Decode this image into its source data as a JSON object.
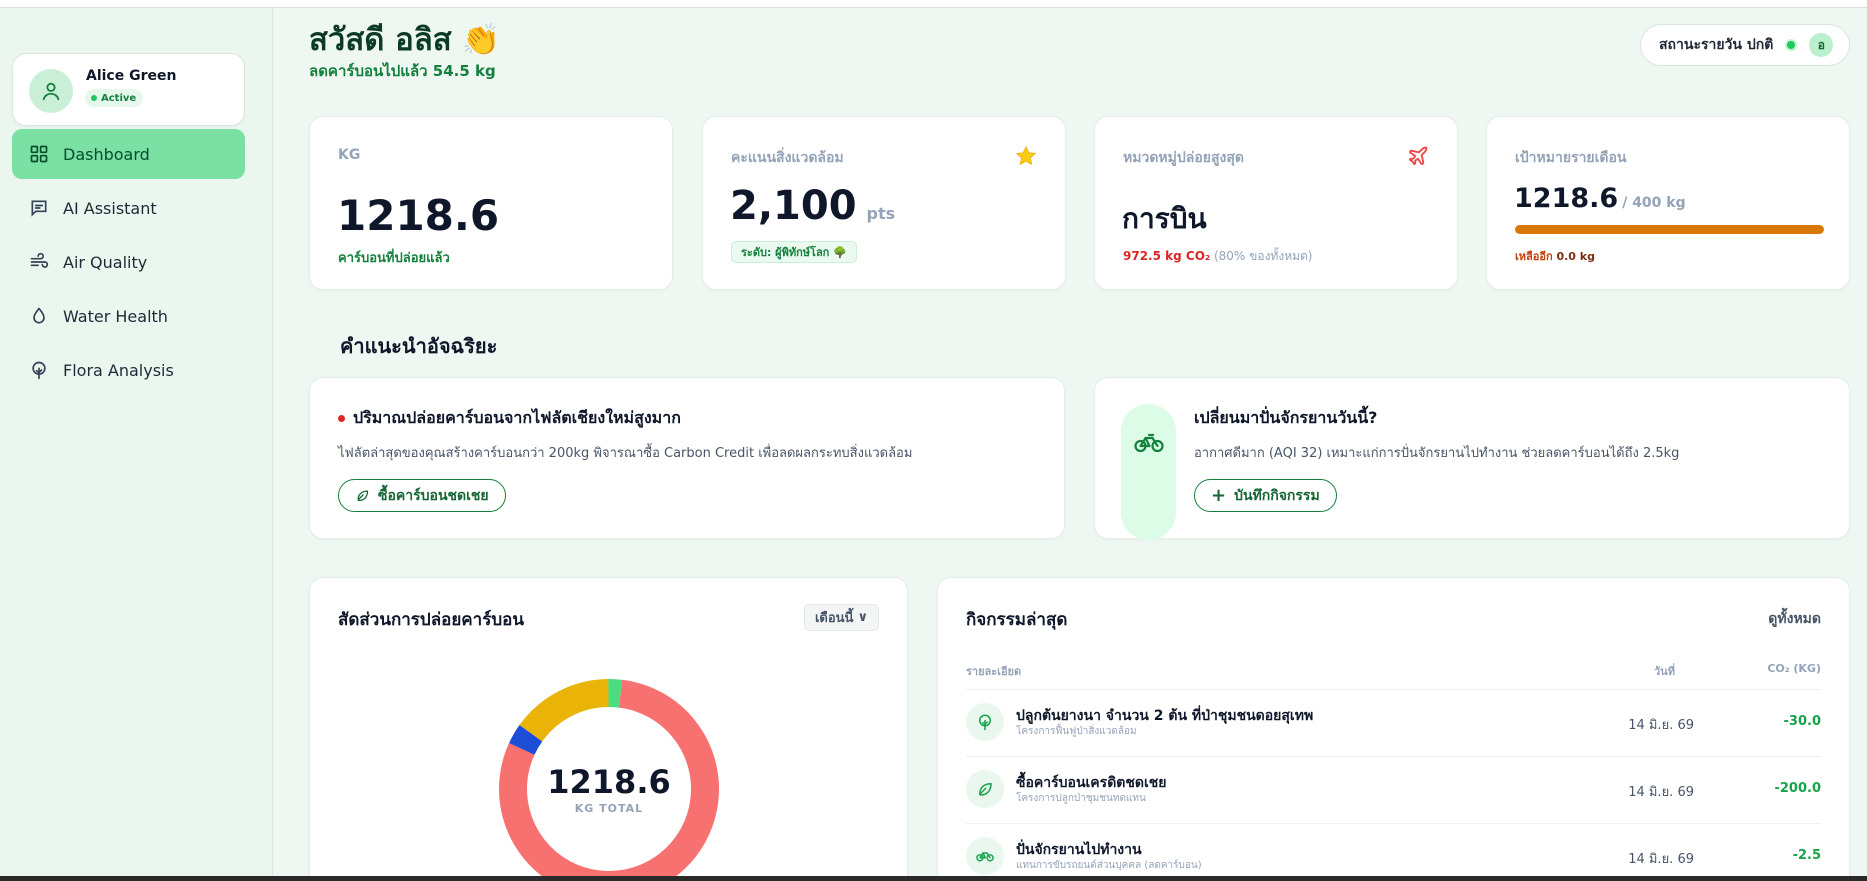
{
  "sidebar": {
    "profile": {
      "name": "Alice Green",
      "status": "Active"
    },
    "items": [
      {
        "label": "Dashboard",
        "icon": "grid-icon",
        "active": true
      },
      {
        "label": "AI Assistant",
        "icon": "chat-icon",
        "active": false
      },
      {
        "label": "Air Quality",
        "icon": "wind-icon",
        "active": false
      },
      {
        "label": "Water Health",
        "icon": "droplet-icon",
        "active": false
      },
      {
        "label": "Flora Analysis",
        "icon": "tree-icon",
        "active": false
      }
    ]
  },
  "header": {
    "greeting": "สวัสดี อลิส",
    "emoji": "👏",
    "subtitle": "ลดคาร์บอนไปแล้ว 54.5 kg",
    "status_label": "สถานะรายวัน ปกติ",
    "user_initial": "อ"
  },
  "stats": {
    "emissions": {
      "label": "KG",
      "value": "1218.6",
      "sub": "คาร์บอนที่ปล่อยแล้ว"
    },
    "score": {
      "label": "คะแนนสิ่งแวดล้อม",
      "value": "2,100",
      "unit": "pts",
      "level": "ระดับ: ผู้พิทักษ์โลก 🌳"
    },
    "category": {
      "label": "หมวดหมู่ปล่อยสูงสุด",
      "value": "การบิน",
      "sub_value": "972.5 kg CO₂",
      "sub_note": "(80% ของทั้งหมด)"
    },
    "goal": {
      "label": "เป้าหมายรายเดือน",
      "value": "1218.6",
      "target": "/ 400 kg",
      "progress": 1.0,
      "remaining_label": "เหลืออีก",
      "remaining_value": "0.0 kg"
    }
  },
  "recommendations": {
    "title": "คำแนะนำอัจฉริยะ",
    "items": [
      {
        "title": "ปริมาณปล่อยคาร์บอนจากไฟลัตเชียงใหม่สูงมาก",
        "text": "ไฟลัตล่าสุดของคุณสร้างคาร์บอนกว่า 200kg พิจารณาซื้อ Carbon Credit เพื่อลดผลกระทบสิ่งแวดล้อม",
        "button": "ซื้อคาร์บอนชดเชย"
      },
      {
        "title": "เปลี่ยนมาปั่นจักรยานวันนี้?",
        "text": "อากาศดีมาก (AQI 32) เหมาะแก่การปั่นจักรยานไปทำงาน ช่วยลดคาร์บอนได้ถึง 2.5kg",
        "button": "บันทึกกิจกรรม"
      }
    ]
  },
  "breakdown": {
    "title": "สัดส่วนการปล่อยคาร์บอน",
    "period": "เดือนนี้",
    "total": "1218.6",
    "total_label": "KG TOTAL",
    "colors": {
      "flight": "#f87171",
      "blue": "#1d4ed8",
      "yellow": "#eab308",
      "green": "#4ade80"
    }
  },
  "chart_data": {
    "type": "pie",
    "categories": [
      "การบิน",
      "",
      "",
      ""
    ],
    "values": [
      972.5,
      36.6,
      182.8,
      24.4
    ],
    "colors": [
      "#f87171",
      "#1d4ed8",
      "#eab308",
      "#4ade80"
    ],
    "title": "สัดส่วนการปล่อยคาร์บอน"
  },
  "activity": {
    "title": "กิจกรรมล่าสุด",
    "view_all": "ดูทั้งหมด",
    "columns": [
      "รายละเอียด",
      "วันที่",
      "CO₂ (KG)"
    ],
    "rows": [
      {
        "icon": "tree-icon",
        "title": "ปลูกต้นยางนา จำนวน 2 ต้น ที่ป่าชุมชนดอยสุเทพ",
        "sub": "โครงการฟื้นฟูป่าสิ่งแวดล้อม",
        "date": "14 มิ.ย. 69",
        "value": "-30.0"
      },
      {
        "icon": "leaf-icon",
        "title": "ซื้อคาร์บอนเครดิตชดเชย",
        "sub": "โครงการปลูกป่าชุมชนทดแทน",
        "date": "14 มิ.ย. 69",
        "value": "-200.0"
      },
      {
        "icon": "bike-icon",
        "title": "ปั่นจักรยานไปทำงาน",
        "sub": "แทนการขับรถยนต์ส่วนบุคคล (ลดคาร์บอน)",
        "date": "14 มิ.ย. 69",
        "value": "-2.5"
      }
    ]
  }
}
